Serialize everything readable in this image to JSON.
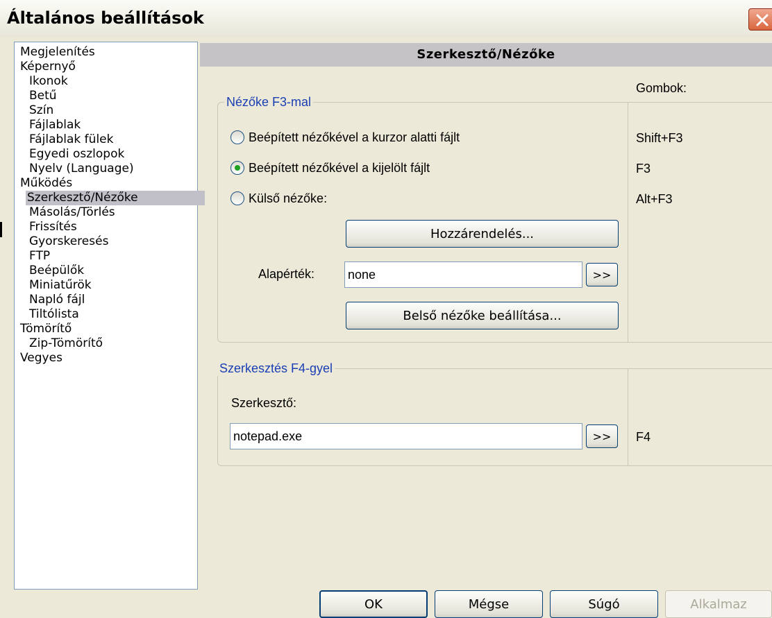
{
  "window": {
    "title": "Általános beállítások"
  },
  "tree": [
    {
      "label": "Megjelenítés",
      "level": 0
    },
    {
      "label": "Képernyő",
      "level": 0
    },
    {
      "label": "Ikonok",
      "level": 1
    },
    {
      "label": "Betű",
      "level": 1
    },
    {
      "label": "Szín",
      "level": 1
    },
    {
      "label": "Fájlablak",
      "level": 1
    },
    {
      "label": "Fájlablak fülek",
      "level": 1
    },
    {
      "label": "Egyedi oszlopok",
      "level": 1
    },
    {
      "label": "Nyelv (Language)",
      "level": 1
    },
    {
      "label": "Működés",
      "level": 0
    },
    {
      "label": "Szerkesztő/Nézőke",
      "level": 1,
      "selected": true
    },
    {
      "label": "Másolás/Törlés",
      "level": 1
    },
    {
      "label": "Frissítés",
      "level": 1
    },
    {
      "label": "Gyorskeresés",
      "level": 1
    },
    {
      "label": "FTP",
      "level": 1
    },
    {
      "label": "Beépülők",
      "level": 1
    },
    {
      "label": "Miniatűrök",
      "level": 1
    },
    {
      "label": "Napló fájl",
      "level": 1
    },
    {
      "label": "Tiltólista",
      "level": 1
    },
    {
      "label": "Tömörítő",
      "level": 0
    },
    {
      "label": "Zip-Tömörítő",
      "level": 1
    },
    {
      "label": "Vegyes",
      "level": 0
    }
  ],
  "panel": {
    "header": "Szerkesztő/Nézőke",
    "keys_heading": "Gombok:",
    "viewer_group": {
      "legend": "Nézőke F3-mal",
      "options": [
        {
          "label": "Beépített nézőkével a kurzor alatti fájlt",
          "key": "Shift+F3",
          "checked": false
        },
        {
          "label": "Beépített nézőkével a kijelölt fájlt",
          "key": "F3",
          "checked": true
        },
        {
          "label": "Külső nézőke:",
          "key": "Alt+F3",
          "checked": false
        }
      ],
      "assign_button": "Hozzárendelés...",
      "default_label": "Alapérték:",
      "default_value": "none",
      "browse_button": ">>",
      "internal_viewer_button": "Belső nézőke beállítása..."
    },
    "editor_group": {
      "legend": "Szerkesztés F4-gyel",
      "editor_label": "Szerkesztő:",
      "editor_value": "notepad.exe",
      "browse_button": ">>",
      "key": "F4"
    }
  },
  "footer": {
    "ok": "OK",
    "cancel": "Mégse",
    "help": "Súgó",
    "apply": "Alkalmaz"
  },
  "colors": {
    "dialog_bg": "#ece9d8",
    "legend_text": "#1a3fb4",
    "selected_item": "#c1c0c9",
    "close_button": "#d9663e",
    "checked_radio": "#21a121"
  }
}
